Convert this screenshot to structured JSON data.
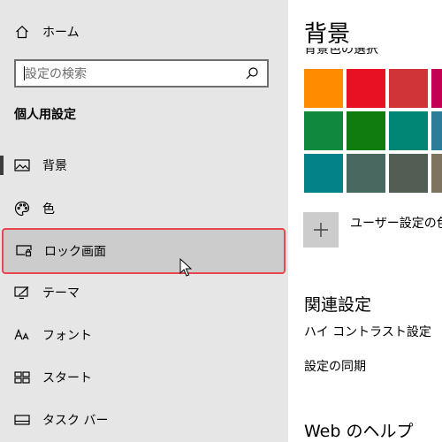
{
  "sidebar": {
    "home_label": "ホーム",
    "search": {
      "placeholder": "設定の検索"
    },
    "section_title": "個人用設定",
    "items": [
      {
        "label": "背景",
        "icon": "image-icon"
      },
      {
        "label": "色",
        "icon": "palette-icon"
      },
      {
        "label": "ロック画面",
        "icon": "lock-screen-icon"
      },
      {
        "label": "テーマ",
        "icon": "theme-icon"
      },
      {
        "label": "フォント",
        "icon": "font-icon"
      },
      {
        "label": "スタート",
        "icon": "start-icon"
      },
      {
        "label": "タスク バー",
        "icon": "taskbar-icon"
      }
    ],
    "selected": "背景",
    "hovered": "ロック画面"
  },
  "main": {
    "title": "背景",
    "subtitle": "背景色の選択",
    "swatches": [
      [
        "#ff8c00",
        "#e81123",
        "#d13438",
        "#c30052"
      ],
      [
        "#10893e",
        "#107c10",
        "#018574",
        "#2d7d9a"
      ],
      [
        "#038387",
        "#486860",
        "#525e54",
        "#7e735f"
      ]
    ],
    "custom_color_label": "ユーザー設定の色",
    "related_title": "関連設定",
    "links": [
      "ハイ コントラスト設定",
      "設定の同期"
    ],
    "help_title": "Web のヘルプ"
  },
  "colors": {
    "highlight_border": "#e8474e",
    "sidebar_bg": "#e6e6e6",
    "hover_bg": "#cccccc"
  }
}
